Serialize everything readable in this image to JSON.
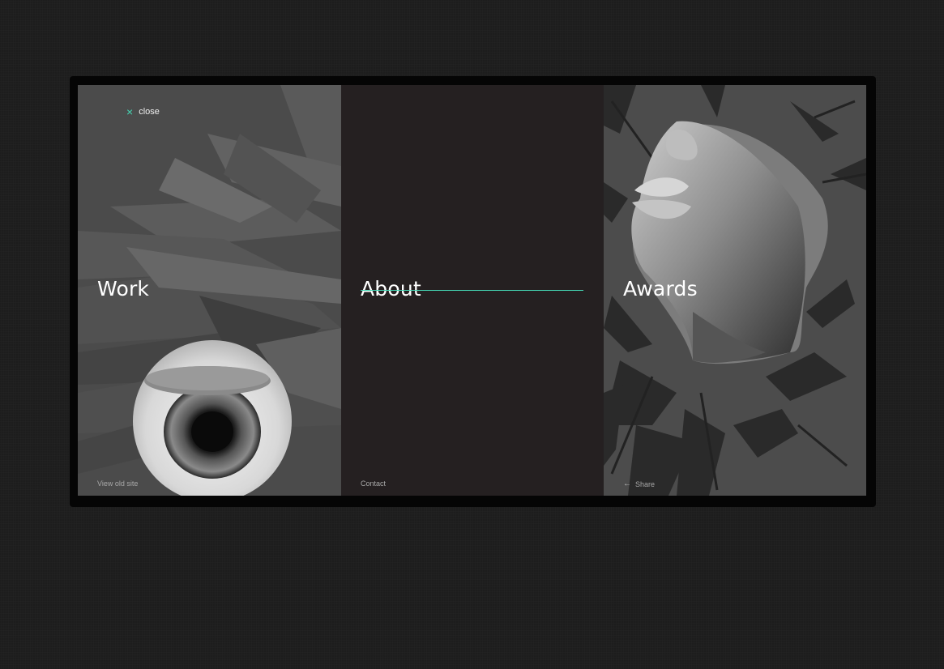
{
  "nav": {
    "close_label": "close",
    "close_icon": "×",
    "arrow_icon": "←"
  },
  "panels": {
    "work": {
      "title": "Work",
      "footer": "View old site"
    },
    "about": {
      "title": "About",
      "footer": "Contact"
    },
    "awards": {
      "title": "Awards",
      "footer": "Share"
    }
  },
  "colors": {
    "accent": "#45d6b4",
    "work_bg": "#4b4b4b",
    "about_bg": "#252021",
    "awards_bg": "#4c4c4c"
  }
}
